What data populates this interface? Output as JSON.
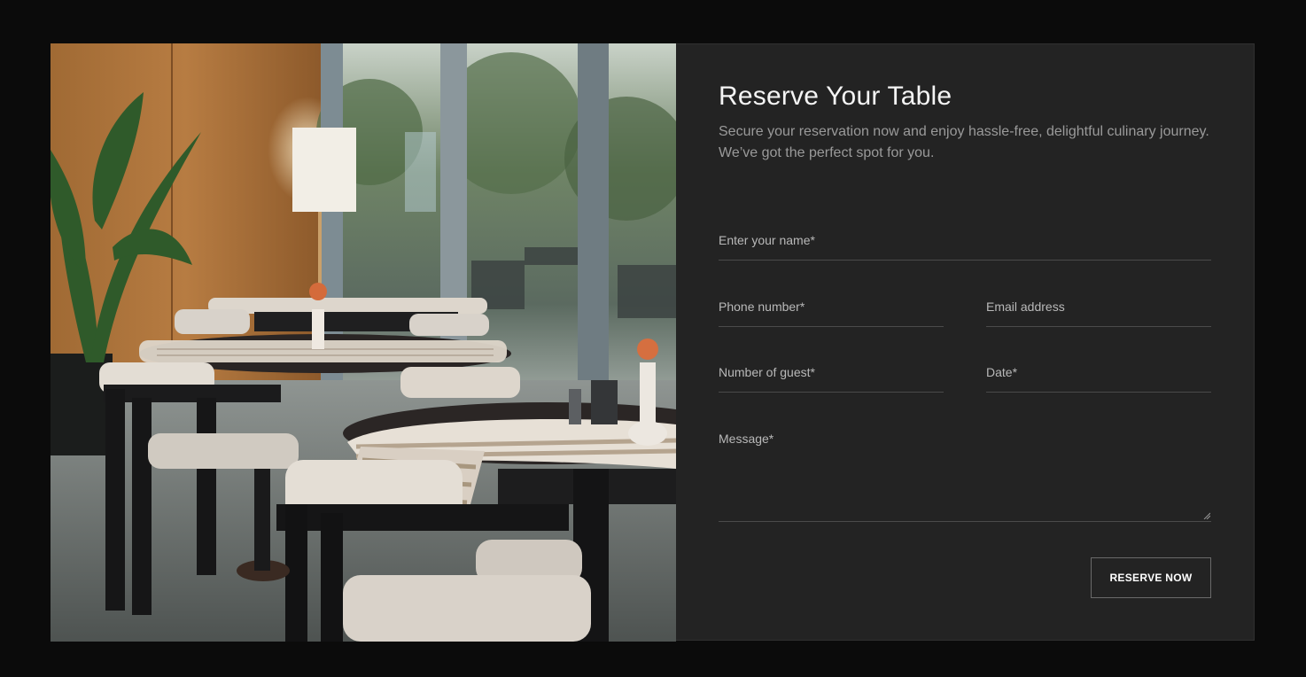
{
  "reservation": {
    "title": "Reserve Your Table",
    "subtitle": "Secure your reservation now and enjoy hassle-free, delightful culinary journey. We’ve got the perfect spot for you.",
    "fields": {
      "name": {
        "label": "Enter your name*",
        "value": ""
      },
      "phone": {
        "label": "Phone number*",
        "value": ""
      },
      "email": {
        "label": "Email address",
        "value": ""
      },
      "guests": {
        "label": "Number of guest*",
        "value": ""
      },
      "date": {
        "label": "Date*",
        "value": ""
      },
      "message": {
        "label": "Message*",
        "value": ""
      }
    },
    "submit_label": "RESERVE NOW"
  },
  "colors": {
    "page_background": "#0b0b0b",
    "panel_background": "#232323",
    "field_border": "#4a4a4a",
    "button_border": "#6a6a6a",
    "text_primary": "#f4f4f4",
    "text_secondary": "#9a9a9a"
  }
}
